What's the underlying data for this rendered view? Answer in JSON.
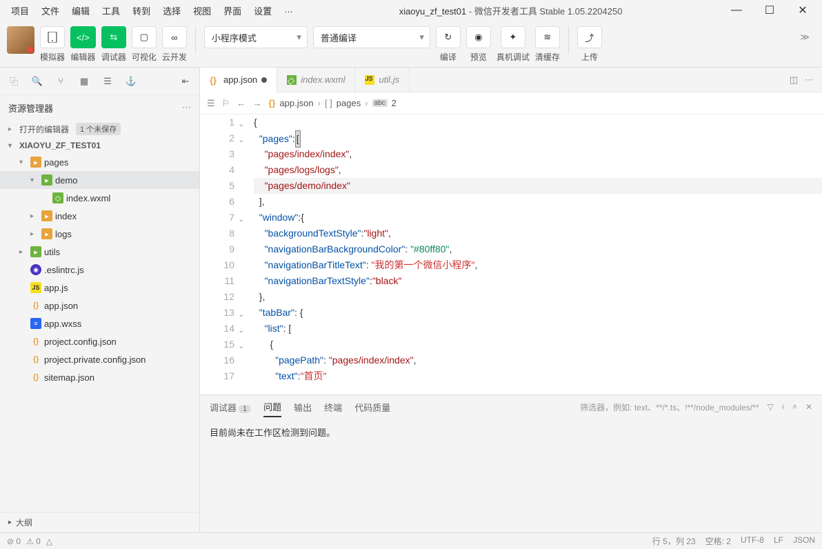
{
  "menu": [
    "项目",
    "文件",
    "编辑",
    "工具",
    "转到",
    "选择",
    "视图",
    "界面",
    "设置",
    "…"
  ],
  "title": {
    "project": "xiaoyu_zf_test01",
    "suffix": " - 微信开发者工具 Stable 1.05.2204250"
  },
  "toolbar": {
    "simulator": "模拟器",
    "editor": "编辑器",
    "debugger": "调试器",
    "visualize": "可视化",
    "cloud": "云开发",
    "mode": "小程序模式",
    "compile_mode": "普通编译",
    "compile": "编译",
    "preview": "预览",
    "real_debug": "真机调试",
    "clear_cache": "清缓存",
    "upload": "上传"
  },
  "explorer": {
    "title": "资源管理器",
    "open_editors": "打开的编辑器",
    "unsaved": "1 个未保存",
    "project": "XIAOYU_ZF_TEST01",
    "tree": [
      {
        "d": 1,
        "exp": true,
        "ico": "folder",
        "name": "pages"
      },
      {
        "d": 2,
        "exp": true,
        "ico": "folder-g",
        "name": "demo",
        "sel": true
      },
      {
        "d": 3,
        "ico": "wxml",
        "name": "index.wxml"
      },
      {
        "d": 2,
        "exp": false,
        "ico": "folder",
        "name": "index"
      },
      {
        "d": 2,
        "exp": false,
        "ico": "folder",
        "name": "logs"
      },
      {
        "d": 1,
        "exp": false,
        "ico": "folder-g",
        "name": "utils"
      },
      {
        "d": 1,
        "ico": "eslint",
        "name": ".eslintrc.js"
      },
      {
        "d": 1,
        "ico": "js",
        "name": "app.js"
      },
      {
        "d": 1,
        "ico": "json",
        "name": "app.json"
      },
      {
        "d": 1,
        "ico": "wxss",
        "name": "app.wxss"
      },
      {
        "d": 1,
        "ico": "json",
        "name": "project.config.json"
      },
      {
        "d": 1,
        "ico": "json",
        "name": "project.private.config.json"
      },
      {
        "d": 1,
        "ico": "json",
        "name": "sitemap.json"
      }
    ],
    "outline": "大纲"
  },
  "tabs": [
    {
      "ico": "json",
      "name": "app.json",
      "active": true,
      "dirty": true
    },
    {
      "ico": "wxml",
      "name": "index.wxml"
    },
    {
      "ico": "js",
      "name": "util.js"
    }
  ],
  "breadcrumb": {
    "file": "app.json",
    "seg": "pages",
    "idx": "2"
  },
  "code": {
    "lines": [
      {
        "n": 1,
        "fold": "v",
        "tokens": [
          {
            "t": "{",
            "c": "k-pun"
          }
        ]
      },
      {
        "n": 2,
        "fold": "v",
        "tokens": [
          {
            "t": "  ",
            "c": ""
          },
          {
            "t": "\"pages\"",
            "c": "k-prop"
          },
          {
            "t": ":",
            "c": "k-pun"
          },
          {
            "t": "[",
            "c": "k-pun",
            "caret": true
          }
        ]
      },
      {
        "n": 3,
        "tokens": [
          {
            "t": "    ",
            "c": ""
          },
          {
            "t": "\"pages/index/index\"",
            "c": "k-str"
          },
          {
            "t": ",",
            "c": "k-pun"
          }
        ]
      },
      {
        "n": 4,
        "tokens": [
          {
            "t": "    ",
            "c": ""
          },
          {
            "t": "\"pages/logs/logs\"",
            "c": "k-str"
          },
          {
            "t": ",",
            "c": "k-pun"
          }
        ]
      },
      {
        "n": 5,
        "hl": true,
        "tokens": [
          {
            "t": "    ",
            "c": ""
          },
          {
            "t": "\"pages/demo/index\"",
            "c": "k-str"
          }
        ]
      },
      {
        "n": 6,
        "tokens": [
          {
            "t": "  ",
            "c": ""
          },
          {
            "t": "]",
            "c": "k-pun"
          },
          {
            "t": ",",
            "c": "k-pun"
          }
        ]
      },
      {
        "n": 7,
        "fold": "v",
        "tokens": [
          {
            "t": "  ",
            "c": ""
          },
          {
            "t": "\"window\"",
            "c": "k-prop"
          },
          {
            "t": ":{",
            "c": "k-pun"
          }
        ]
      },
      {
        "n": 8,
        "tokens": [
          {
            "t": "    ",
            "c": ""
          },
          {
            "t": "\"backgroundTextStyle\"",
            "c": "k-prop"
          },
          {
            "t": ":",
            "c": "k-pun"
          },
          {
            "t": "\"light\"",
            "c": "k-str"
          },
          {
            "t": ",",
            "c": "k-pun"
          }
        ]
      },
      {
        "n": 9,
        "tokens": [
          {
            "t": "    ",
            "c": ""
          },
          {
            "t": "\"navigationBarBackgroundColor\"",
            "c": "k-prop"
          },
          {
            "t": ": ",
            "c": "k-pun"
          },
          {
            "t": "\"#80ff80\"",
            "c": "k-num-str"
          },
          {
            "t": ",",
            "c": "k-pun"
          }
        ]
      },
      {
        "n": 10,
        "tokens": [
          {
            "t": "    ",
            "c": ""
          },
          {
            "t": "\"navigationBarTitleText\"",
            "c": "k-prop"
          },
          {
            "t": ": ",
            "c": "k-pun"
          },
          {
            "t": "\"我的第一个微信小程序\"",
            "c": "k-cn"
          },
          {
            "t": ",",
            "c": "k-pun"
          }
        ]
      },
      {
        "n": 11,
        "tokens": [
          {
            "t": "    ",
            "c": ""
          },
          {
            "t": "\"navigationBarTextStyle\"",
            "c": "k-prop"
          },
          {
            "t": ":",
            "c": "k-pun"
          },
          {
            "t": "\"black\"",
            "c": "k-str"
          }
        ]
      },
      {
        "n": 12,
        "tokens": [
          {
            "t": "  ",
            "c": ""
          },
          {
            "t": "},",
            "c": "k-pun"
          }
        ]
      },
      {
        "n": 13,
        "fold": "v",
        "tokens": [
          {
            "t": "  ",
            "c": ""
          },
          {
            "t": "\"tabBar\"",
            "c": "k-prop"
          },
          {
            "t": ": {",
            "c": "k-pun"
          }
        ]
      },
      {
        "n": 14,
        "fold": "v",
        "tokens": [
          {
            "t": "    ",
            "c": ""
          },
          {
            "t": "\"list\"",
            "c": "k-prop"
          },
          {
            "t": ": [",
            "c": "k-pun"
          }
        ]
      },
      {
        "n": 15,
        "fold": "v",
        "tokens": [
          {
            "t": "      ",
            "c": ""
          },
          {
            "t": "{",
            "c": "k-pun"
          }
        ]
      },
      {
        "n": 16,
        "tokens": [
          {
            "t": "        ",
            "c": ""
          },
          {
            "t": "\"pagePath\"",
            "c": "k-prop"
          },
          {
            "t": ": ",
            "c": "k-pun"
          },
          {
            "t": "\"pages/index/index\"",
            "c": "k-str"
          },
          {
            "t": ",",
            "c": "k-pun"
          }
        ]
      },
      {
        "n": 17,
        "tokens": [
          {
            "t": "        ",
            "c": ""
          },
          {
            "t": "\"text\"",
            "c": "k-prop"
          },
          {
            "t": ":",
            "c": "k-pun"
          },
          {
            "t": "\"首页\"",
            "c": "k-cn"
          }
        ]
      }
    ]
  },
  "panel": {
    "tabs": [
      "调试器",
      "问题",
      "输出",
      "终端",
      "代码质量"
    ],
    "debugger_count": "1",
    "filter_ph": "筛选器，例如: text、**/*.ts、!**/node_modules/**",
    "msg": "目前尚未在工作区检测到问题。"
  },
  "status": {
    "left": [
      "⊘ 0",
      "⚠ 0",
      "△"
    ],
    "right": [
      "行 5，列 23",
      "空格: 2",
      "UTF-8",
      "LF",
      "JSON"
    ]
  }
}
